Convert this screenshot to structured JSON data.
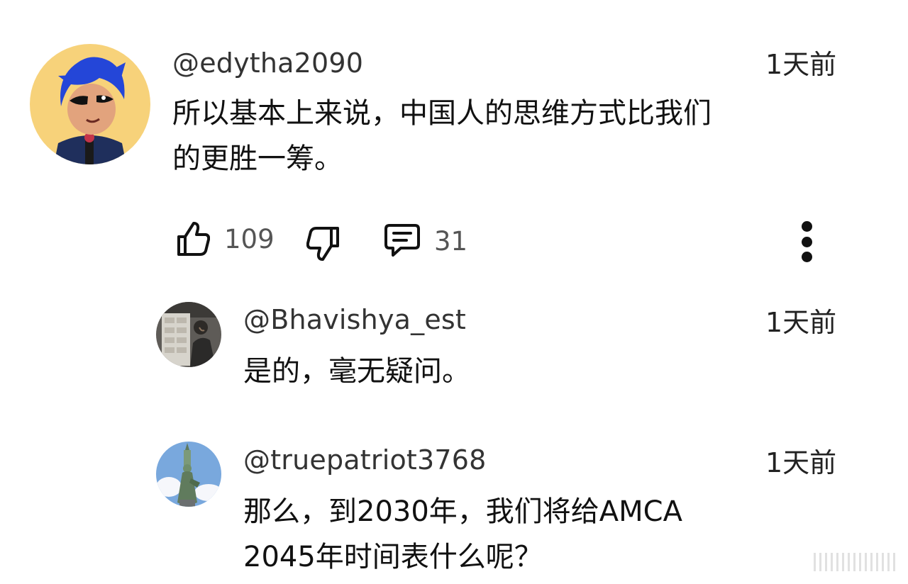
{
  "comments": [
    {
      "username": "@edytha2090",
      "time": "1天前",
      "text": "所以基本上来说，中国人的思维方式比我们\n的更胜一筹。",
      "avatar_icon": "anime-avatar-icon",
      "likes": "109",
      "replies": "31"
    },
    {
      "username": "@Bhavishya_est",
      "time": "1天前",
      "text": "是的，毫无疑问。",
      "avatar_icon": "photo-avatar-icon"
    },
    {
      "username": "@truepatriot3768",
      "time": "1天前",
      "text": "那么，到2030年，我们将给AMCA\n2045年时间表什么呢？",
      "avatar_icon": "statue-of-liberty-avatar-icon"
    }
  ],
  "icons": {
    "like": "thumbs-up-icon",
    "dislike": "thumbs-down-icon",
    "reply": "comment-icon",
    "more": "more-vertical-icon"
  },
  "colors": {
    "text": "#111111",
    "secondary": "#555555",
    "avatar_bg_1": "#f7d27a",
    "avatar_sky_3": "#79a8dd"
  }
}
